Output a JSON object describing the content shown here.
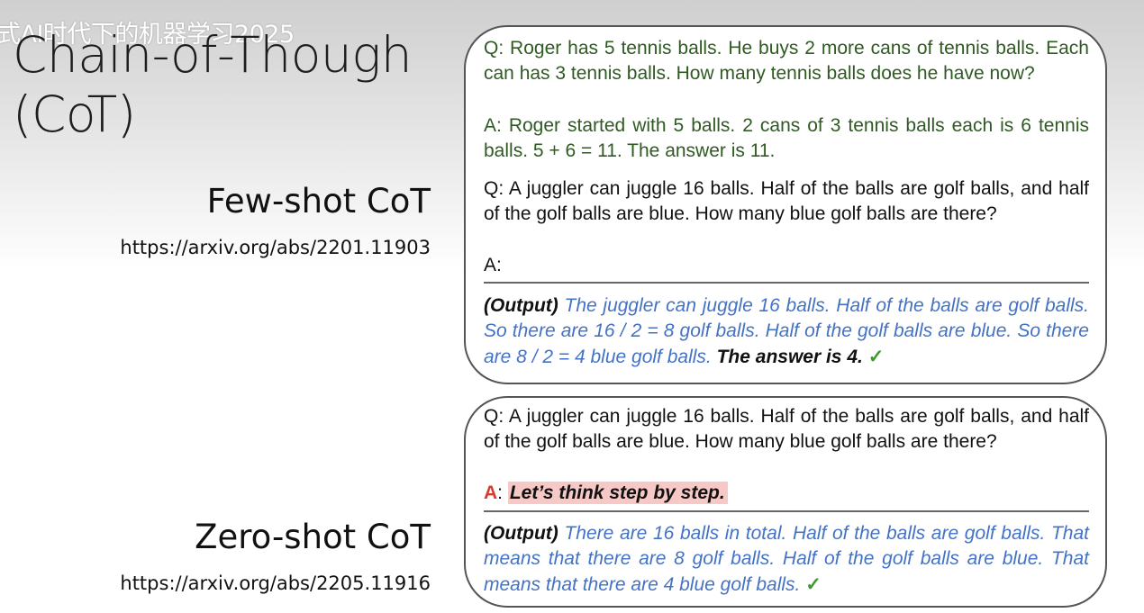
{
  "overlay": {
    "title": "式AI时代下的机器学习2025"
  },
  "slide": {
    "title_line1": "Chain-of-Though",
    "title_line2": "(CoT)"
  },
  "few_shot": {
    "label": "Few-shot CoT",
    "url": "https://arxiv.org/abs/2201.11903",
    "example_q": "Q: Roger has 5 tennis balls. He buys 2 more cans of tennis balls. Each can has 3 tennis balls. How many tennis balls does he have now?",
    "example_a": "A: Roger started with 5 balls. 2 cans of 3 tennis balls each is 6 tennis balls. 5 + 6 = 11. The answer is 11.",
    "question": "Q: A juggler can juggle 16 balls. Half of the balls are golf balls, and half of the golf balls are blue. How many blue golf balls are there?",
    "answer_prompt": "A:",
    "output_label": "(Output)",
    "output_text": "The juggler can juggle 16 balls. Half of the balls are golf balls. So there are 16 / 2 = 8 golf balls. Half of the golf balls are blue. So there are 8 / 2 = 4 blue golf balls.",
    "answer_text": "The answer is 4.",
    "check": "✓"
  },
  "zero_shot": {
    "label": "Zero-shot CoT",
    "url": "https://arxiv.org/abs/2205.11916",
    "question": "Q: A juggler can juggle 16 balls. Half of the balls are golf balls, and half of the golf balls are blue. How many blue golf balls are there?",
    "answer_prefix": "A",
    "answer_colon": ":",
    "think_prompt": "Let’s think step by step.",
    "output_label": "(Output)",
    "output_text": "There are 16 balls in total. Half of the balls are golf balls. That means that there are 8 golf balls. Half of the golf balls are blue. That means that there are 4 blue golf balls.",
    "check": "✓"
  }
}
